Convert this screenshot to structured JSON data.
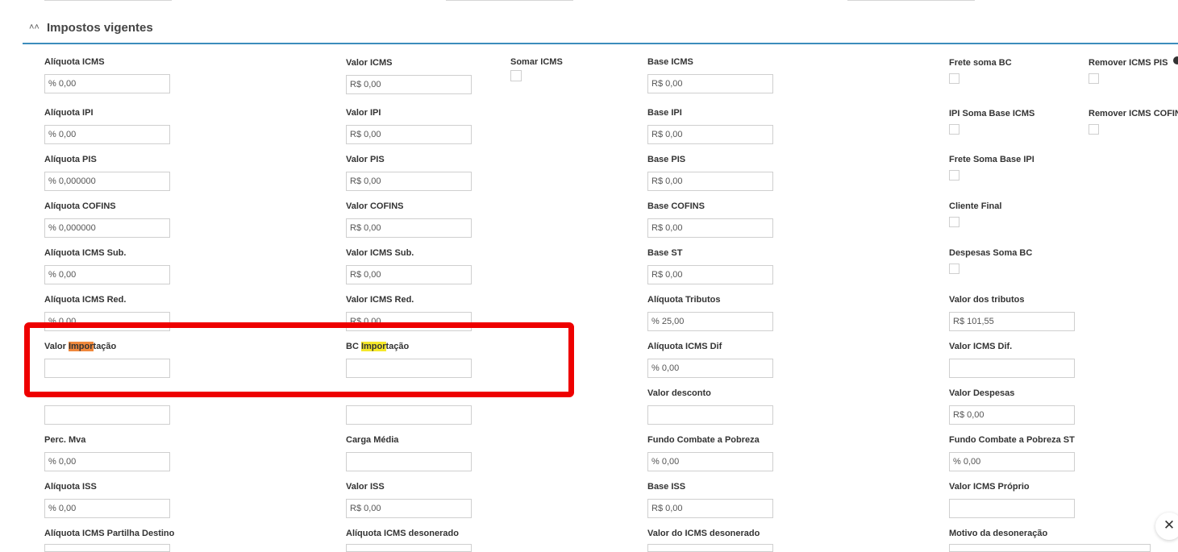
{
  "section": {
    "title": "Impostos vigentes"
  },
  "fields": {
    "aliquota_icms": {
      "label": "Alíquota ICMS",
      "value": "% 0,00"
    },
    "valor_icms": {
      "label": "Valor ICMS",
      "value": "R$ 0,00"
    },
    "somar_icms": {
      "label": "Somar ICMS"
    },
    "base_icms": {
      "label": "Base ICMS",
      "value": "R$ 0,00"
    },
    "frete_soma_bc": {
      "label": "Frete soma BC"
    },
    "remover_icms_pis": {
      "label": "Remover ICMS PIS"
    },
    "aliquota_ipi": {
      "label": "Alíquota IPI",
      "value": "% 0,00"
    },
    "valor_ipi": {
      "label": "Valor IPI",
      "value": "R$ 0,00"
    },
    "base_ipi": {
      "label": "Base IPI",
      "value": "R$ 0,00"
    },
    "ipi_soma_base_icms": {
      "label": "IPI Soma Base ICMS"
    },
    "remover_icms_cofins": {
      "label": "Remover ICMS COFIN"
    },
    "aliquota_pis": {
      "label": "Alíquota PIS",
      "value": "% 0,000000"
    },
    "valor_pis": {
      "label": "Valor PIS",
      "value": "R$ 0,00"
    },
    "base_pis": {
      "label": "Base PIS",
      "value": "R$ 0,00"
    },
    "frete_soma_base_ipi": {
      "label": "Frete Soma Base IPI"
    },
    "aliquota_cofins": {
      "label": "Alíquota COFINS",
      "value": "% 0,000000"
    },
    "valor_cofins": {
      "label": "Valor COFINS",
      "value": "R$ 0,00"
    },
    "base_cofins": {
      "label": "Base COFINS",
      "value": "R$ 0,00"
    },
    "cliente_final": {
      "label": "Cliente Final"
    },
    "aliquota_icms_sub": {
      "label": "Alíquota ICMS Sub.",
      "value": "% 0,00"
    },
    "valor_icms_sub": {
      "label": "Valor ICMS Sub.",
      "value": "R$ 0,00"
    },
    "base_st": {
      "label": "Base ST",
      "value": "R$ 0,00"
    },
    "despesas_soma_bc": {
      "label": "Despesas Soma BC"
    },
    "aliquota_icms_red": {
      "label": "Alíquota ICMS Red.",
      "value": "% 0,00"
    },
    "valor_icms_red": {
      "label": "Valor ICMS Red.",
      "value": "R$ 0,00"
    },
    "aliquota_tributos": {
      "label": "Alíquota Tributos",
      "value": "% 25,00"
    },
    "valor_dos_tributos": {
      "label": "Valor dos tributos",
      "value": "R$ 101,55"
    },
    "valor_importacao": {
      "label_pre": "Valor ",
      "label_hl": "Impor",
      "label_post": "tação",
      "value": ""
    },
    "bc_importacao": {
      "label_pre": "BC ",
      "label_hl": "Impor",
      "label_post": "tação",
      "value": ""
    },
    "aliquota_icms_dif": {
      "label": "Alíquota ICMS Dif",
      "value": "% 0,00"
    },
    "valor_icms_dif": {
      "label": "Valor ICMS Dif.",
      "value": ""
    },
    "hidden_1": {
      "value": ""
    },
    "hidden_2": {
      "value": ""
    },
    "valor_desconto": {
      "label": "Valor desconto",
      "value": ""
    },
    "valor_despesas": {
      "label": "Valor Despesas",
      "value": "R$ 0,00"
    },
    "perc_mva": {
      "label": "Perc. Mva",
      "value": "% 0,00"
    },
    "carga_media": {
      "label": "Carga Média",
      "value": ""
    },
    "fundo_combate_pobreza": {
      "label": "Fundo Combate a Pobreza",
      "value": "% 0,00"
    },
    "fundo_combate_pobreza_st": {
      "label": "Fundo Combate a Pobreza ST",
      "value": "% 0,00"
    },
    "aliquota_iss": {
      "label": "Alíquota ISS",
      "value": "% 0,00"
    },
    "valor_iss": {
      "label": "Valor ISS",
      "value": "R$ 0,00"
    },
    "base_iss": {
      "label": "Base ISS",
      "value": "R$ 0,00"
    },
    "valor_icms_proprio": {
      "label": "Valor ICMS Próprio",
      "value": ""
    },
    "aliquota_icms_partilha_destino": {
      "label": "Alíquota ICMS Partilha Destino"
    },
    "aliquota_icms_desonerado": {
      "label": "Alíquota ICMS desonerado"
    },
    "valor_icms_desonerado": {
      "label": "Valor do ICMS desonerado"
    },
    "motivo_desoneracao": {
      "label": "Motivo da desoneração"
    }
  },
  "icons": {
    "collapse": "chevron-double-up-icon",
    "info": "info-icon",
    "close": "close-icon"
  },
  "colors": {
    "accent": "#3c8dbc",
    "highlight_border": "#ee0000",
    "search_hl_current": "#f0883c",
    "search_hl": "#f5e82a"
  }
}
